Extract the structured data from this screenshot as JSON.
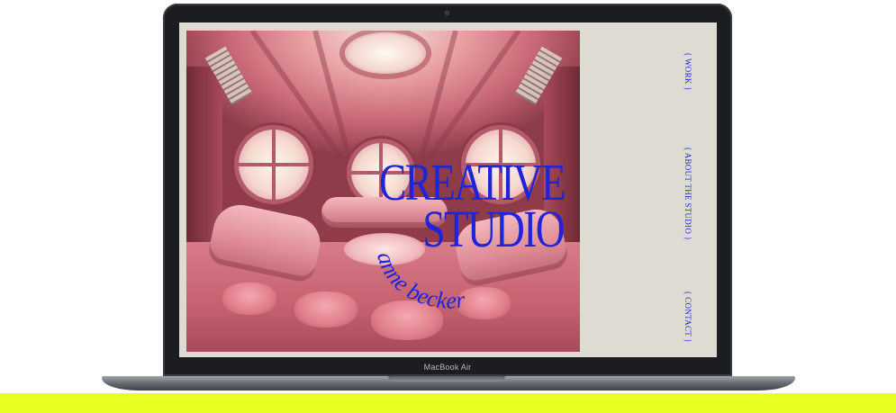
{
  "device": {
    "model_label": "MacBook Air"
  },
  "site": {
    "title_line1": "CREATIVE",
    "title_line2": "STUDIO",
    "signature": "anne becker",
    "nav": [
      {
        "label": "{ WORK }"
      },
      {
        "label": "{ ABOUT THE STUDIO }"
      },
      {
        "label": "{ CONTACT }"
      }
    ],
    "hero_image": "pink-futuristic-lounge"
  },
  "colors": {
    "accent_blue": "#1f23d9",
    "screen_background": "#dedbd3",
    "band_yellow": "#e8ff1f"
  }
}
